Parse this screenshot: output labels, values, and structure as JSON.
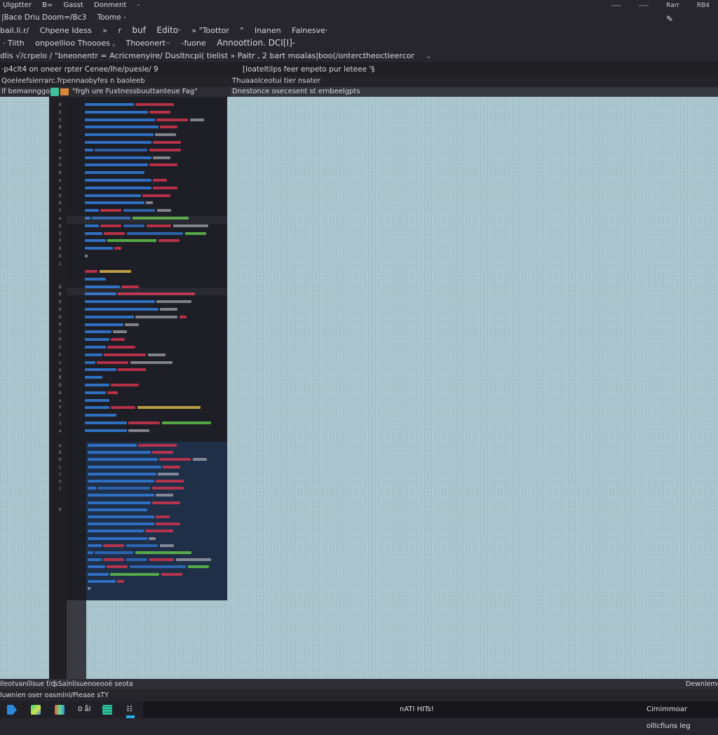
{
  "window": {
    "title_row": [
      "Ulgptter",
      "B=",
      "Gasst",
      "Donment",
      "-"
    ],
    "controls": [
      "Rarr",
      "RB4"
    ]
  },
  "menubar_2": [
    "|Bace Driu Doom=/Bc3",
    "Toome  -"
  ],
  "menubar_3": [
    "bail.li.r/",
    "Chpene Idess",
    "»",
    "r",
    "buf",
    "Edito·",
    "» \"Toottor",
    "\"",
    "Inanen",
    "Fainesve·"
  ],
  "menubar_4": [
    "· Tiith",
    "onpoellioo Thoooes ,",
    "Thoeonert··",
    "-fuone",
    "Annoottion. DCI[I]-"
  ],
  "path_row": {
    "text": "dlis √/crpelo / \"bneonentr = Acricmenyire/  Dusltncpi( tielist » Paitr ,  2  bart moalas|boo(/onterctheoctieercor",
    "dropdown_icon": "chevron-down-icon"
  },
  "toolbar_row": {
    "left": "·p4clt4 on oneer rpter  Cenee/Ihe/puesle/ 9",
    "right": "[loateltilps feer enpeto pur leteee '§"
  },
  "tab_row": {
    "left": "Qoeleefsierrarc.frpennaobyfes n baoleeb",
    "right": "Thuaaolceotui tier nsater"
  },
  "file_row": {
    "left_label": "lf  bemannggoe :",
    "file_name": "\"frgh  ure  Fuxtnessbuuttanteue Fag\"",
    "right_label": "Dnestonce osecesent st ernbeelgpts"
  },
  "editor": {
    "line_numbers": [
      "6",
      "b",
      "3",
      "B",
      "b",
      "F",
      "a",
      "a",
      "b",
      "D",
      "a",
      "a",
      "0",
      "b",
      "F",
      "a",
      "b",
      "5",
      "F",
      "8",
      "b",
      "1",
      "",
      "",
      "8",
      "B",
      "b",
      "b",
      "b",
      "P",
      "F",
      "P",
      "I",
      "F",
      "s",
      "a",
      "B",
      "D",
      "b",
      "a",
      "F",
      "F",
      "1",
      "a",
      "a",
      "b",
      "b",
      "L",
      "r",
      "o",
      "c",
      "",
      "",
      "P"
    ]
  },
  "colors": {
    "canvas": "#a9c4cc",
    "editor_bg": "#1d1e26",
    "token_blue": "#2f6fc1",
    "token_red": "#d1344f",
    "token_green": "#5fbf4a",
    "token_yellow": "#d6b14a",
    "token_white": "#c4c4cc"
  },
  "status_bar_1": {
    "left": "Ileotvaníllsue f/cs",
    "middle": "[ Salnlisuenoeooè seota",
    "right": "Dewnlemeel"
  },
  "status_bar_2": {
    "left": "luwnlen oser oasmlnl/Pieaae sTY"
  },
  "taskbar": {
    "icons": [
      "media-player-icon",
      "image-editor-icon",
      "gallery-icon",
      "text-app-icon",
      "spreadsheet-icon",
      "network-icon"
    ],
    "text_app_label": "0 ål",
    "center_label": "nATI HITs!",
    "right_label": "Cimimmoar olllcfiuns leg"
  }
}
